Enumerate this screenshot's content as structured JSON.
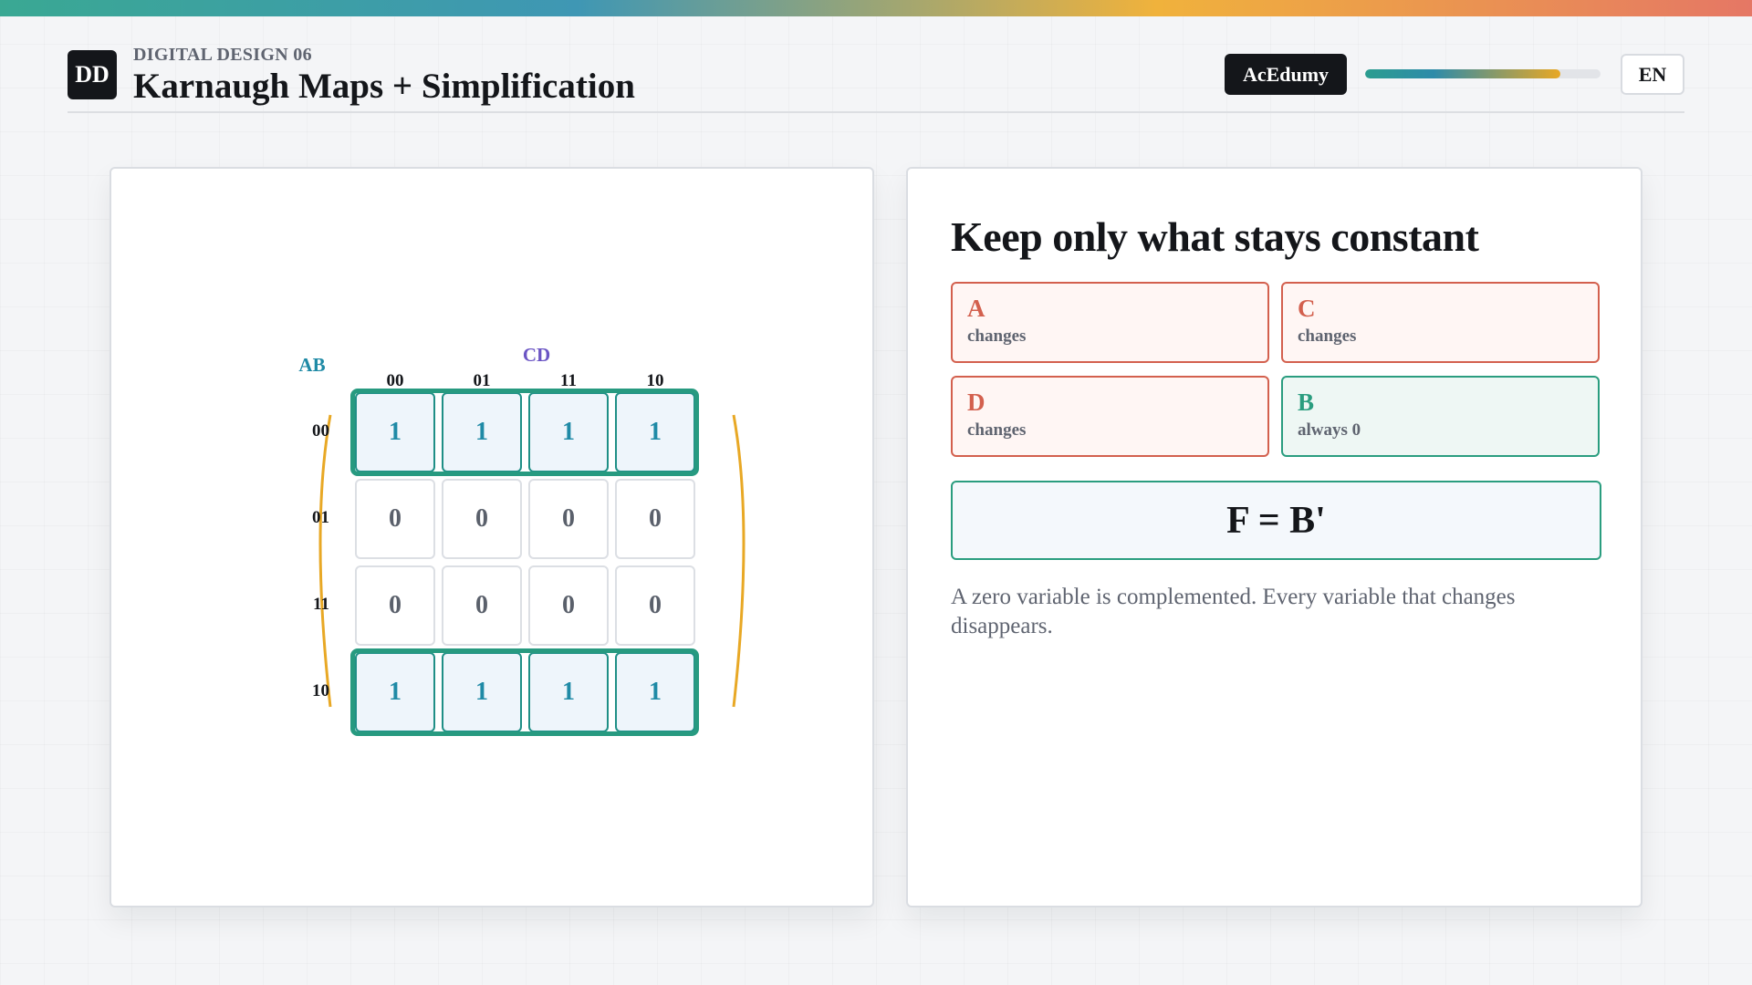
{
  "header": {
    "logo_text": "DD",
    "eyebrow": "DIGITAL DESIGN 06",
    "title": "Karnaugh Maps + Simplification",
    "brand": "AcEdumy",
    "progress": 0.83,
    "language": "EN"
  },
  "kmap": {
    "row_var": "AB",
    "col_var": "CD",
    "col_labels": [
      "00",
      "01",
      "11",
      "10"
    ],
    "row_labels": [
      "00",
      "01",
      "11",
      "10"
    ],
    "cells": [
      [
        "1",
        "1",
        "1",
        "1"
      ],
      [
        "0",
        "0",
        "0",
        "0"
      ],
      [
        "0",
        "0",
        "0",
        "0"
      ],
      [
        "1",
        "1",
        "1",
        "1"
      ]
    ],
    "group_color": "#279a80",
    "wrap_color": "#e8a825"
  },
  "info": {
    "title": "Keep only what stays constant",
    "variables": [
      {
        "name": "A",
        "status": "changes"
      },
      {
        "name": "C",
        "status": "changes"
      },
      {
        "name": "D",
        "status": "changes"
      },
      {
        "name": "B",
        "status": "always 0"
      }
    ],
    "formula": "F = B'",
    "note": "A zero variable is complemented. Every variable that changes disappears."
  },
  "colors": {
    "changes": "#d3604e",
    "constant": "#2a9d7f",
    "ink": "#14161a"
  }
}
